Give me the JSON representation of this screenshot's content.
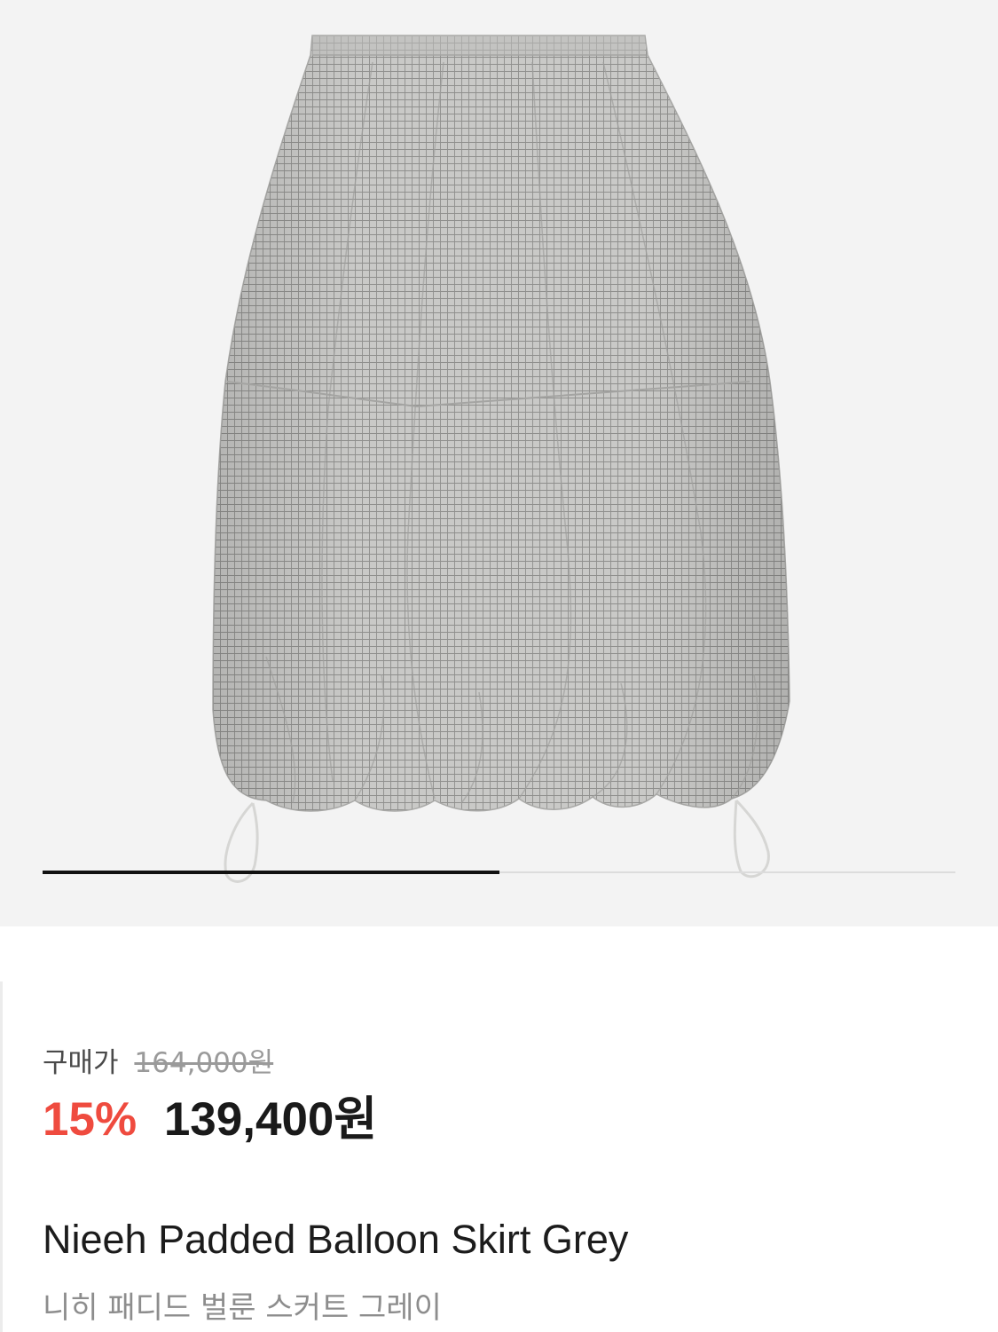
{
  "product": {
    "image_alt": "grey gingham padded balloon skirt",
    "gallery_progress": 0.5,
    "price_label": "구매가",
    "original_price": "164,000원",
    "discount": "15%",
    "sale_price": "139,400원",
    "name_en": "Nieeh Padded Balloon Skirt Grey",
    "name_ko": "니히 패디드 벌룬 스커트 그레이"
  },
  "colors": {
    "hero_bg": "#f3f3f3",
    "discount": "#ef4b3f",
    "progress": "#111111"
  }
}
